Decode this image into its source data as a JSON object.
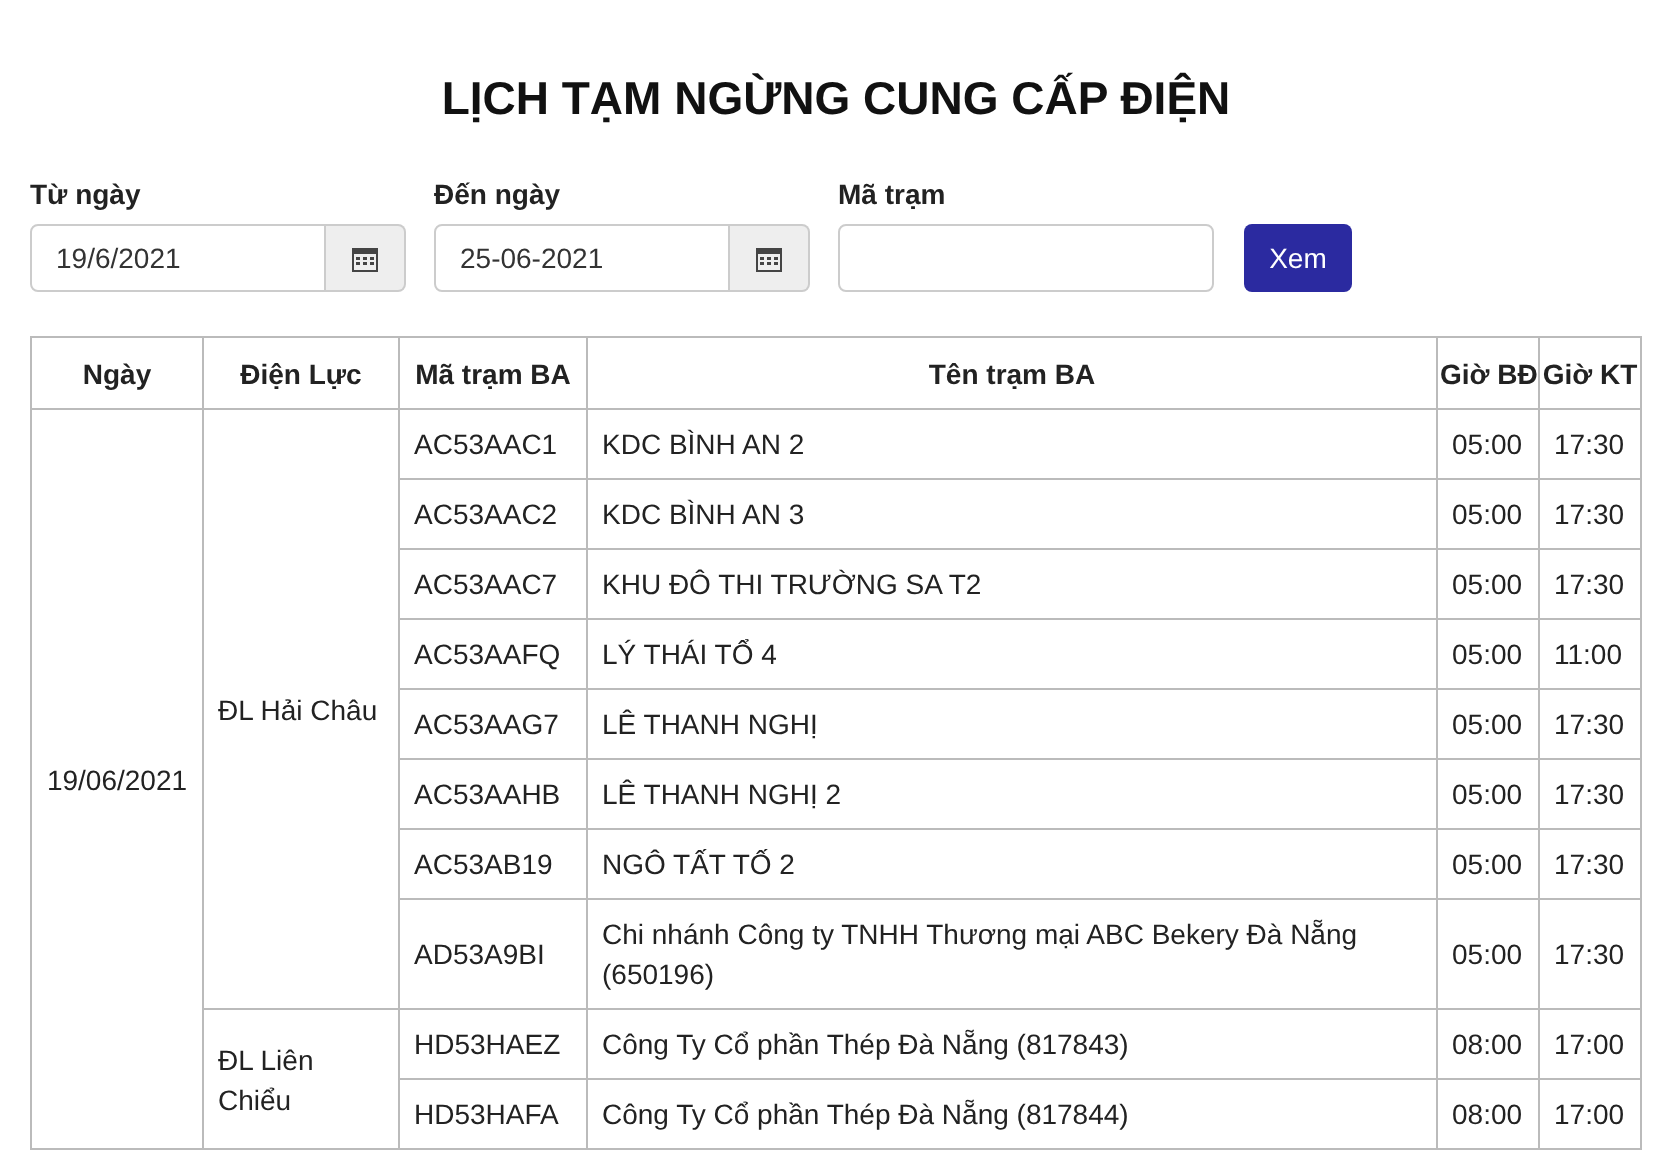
{
  "title": "LỊCH TẠM NGỪNG CUNG CẤP ĐIỆN",
  "filters": [
    {
      "kind": "date",
      "label": "Từ ngày",
      "value": "19/6/2021"
    },
    {
      "kind": "date",
      "label": "Đến ngày",
      "value": "25-06-2021"
    },
    {
      "kind": "text",
      "label": "Mã trạm"
    }
  ],
  "view_button": "Xem",
  "table": {
    "columns": [
      "Ngày",
      "Điện Lực",
      "Mã trạm BA",
      "Tên trạm BA",
      "Giờ BĐ",
      "Giờ KT"
    ],
    "groups": [
      {
        "date": "19/06/2021",
        "districts": [
          {
            "name": "ĐL Hải Châu",
            "rows": [
              {
                "code": "AC53AAC1",
                "name": "KDC BÌNH AN 2",
                "start": "05:00",
                "end": "17:30"
              },
              {
                "code": "AC53AAC2",
                "name": "KDC BÌNH AN 3",
                "start": "05:00",
                "end": "17:30"
              },
              {
                "code": "AC53AAC7",
                "name": "KHU ĐÔ THI TRƯỜNG SA T2",
                "start": "05:00",
                "end": "17:30"
              },
              {
                "code": "AC53AAFQ",
                "name": "LÝ THÁI TỔ 4",
                "start": "05:00",
                "end": "11:00"
              },
              {
                "code": "AC53AAG7",
                "name": "LÊ THANH NGHỊ",
                "start": "05:00",
                "end": "17:30"
              },
              {
                "code": "AC53AAHB",
                "name": "LÊ THANH NGHỊ 2",
                "start": "05:00",
                "end": "17:30"
              },
              {
                "code": "AC53AB19",
                "name": "NGÔ TẤT TỐ 2",
                "start": "05:00",
                "end": "17:30"
              },
              {
                "code": "AD53A9BI",
                "name": "Chi nhánh Công ty TNHH Thương mại ABC Bekery Đà Nẵng (650196)",
                "start": "05:00",
                "end": "17:30"
              }
            ]
          },
          {
            "name": "ĐL Liên Chiểu",
            "rows": [
              {
                "code": "HD53HAEZ",
                "name": "Công Ty Cổ phần Thép Đà Nẵng (817843)",
                "start": "08:00",
                "end": "17:00"
              },
              {
                "code": "HD53HAFA",
                "name": "Công Ty Cổ phần Thép Đà Nẵng (817844)",
                "start": "08:00",
                "end": "17:00"
              }
            ]
          }
        ]
      }
    ]
  }
}
